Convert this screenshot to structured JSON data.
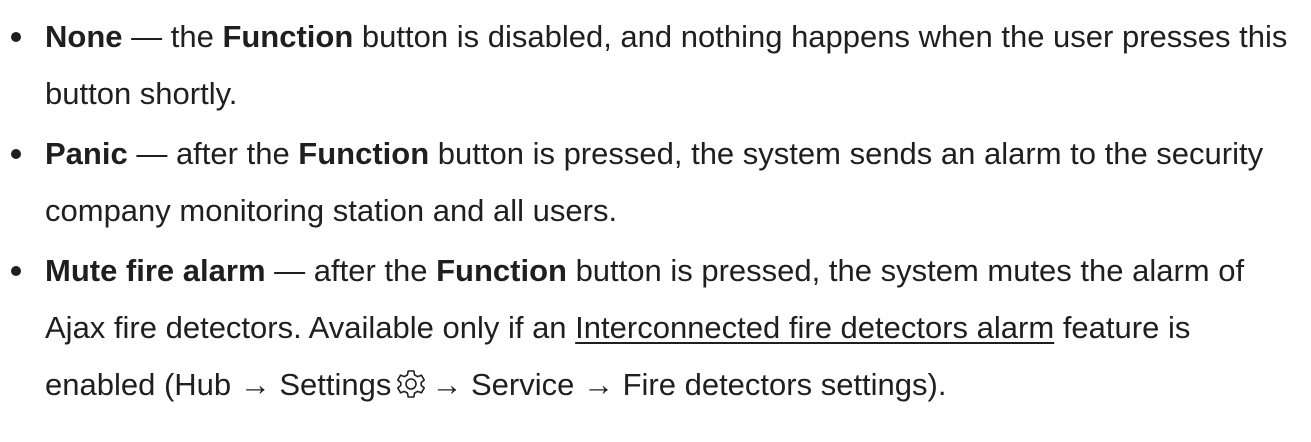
{
  "items": [
    {
      "term": "None",
      "t1": " — the ",
      "kw": "Function",
      "t2": " button is disabled, and nothing happens when the user presses this button shortly."
    },
    {
      "term": "Panic",
      "t1": " — after the ",
      "kw": "Function",
      "t2": " button is pressed, the system sends an alarm to the security company monitoring station and all users."
    },
    {
      "term": "Mute fire alarm",
      "t1": " — after the ",
      "kw": "Function",
      "t2": " button is pressed, the system mutes the alarm of Ajax fire detectors. Available only if an ",
      "link": "Interconnected fire detectors alarm",
      "t3": " feature is enabled (Hub → Settings",
      "icon": "gear-icon",
      "t4": "→ Service → Fire detectors settings)."
    }
  ]
}
